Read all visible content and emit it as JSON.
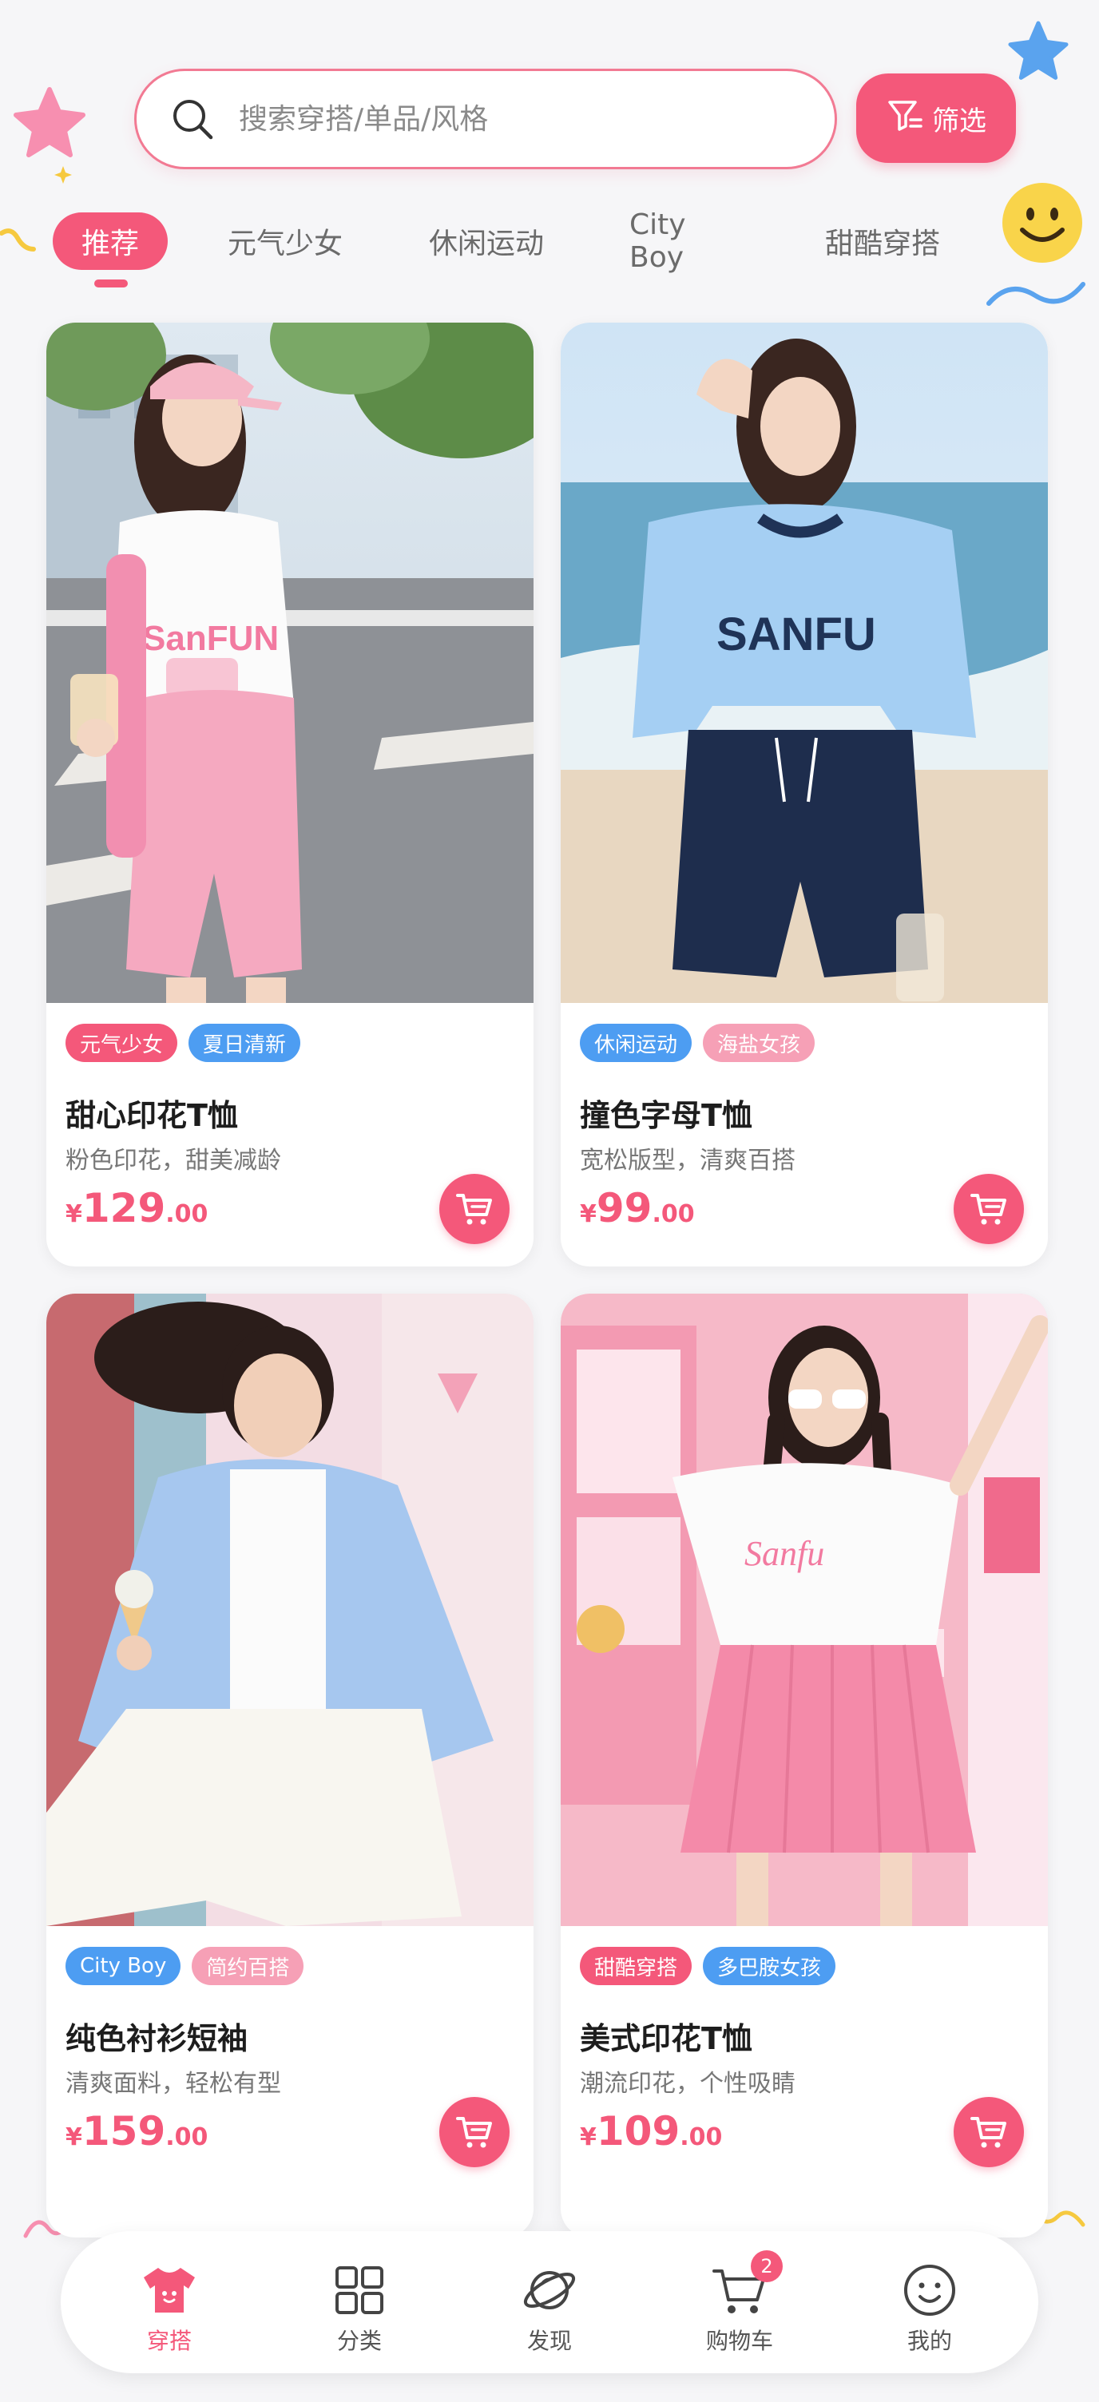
{
  "search": {
    "placeholder": "搜索穿搭/单品/风格"
  },
  "filter": {
    "label": "筛选",
    "icon": "filter-icon"
  },
  "tabs": [
    {
      "label": "推荐",
      "active": true
    },
    {
      "label": "元气少女"
    },
    {
      "label": "休闲运动"
    },
    {
      "label": "City Boy"
    },
    {
      "label": "甜酷穿搭"
    }
  ],
  "products": [
    {
      "tags": [
        "元气少女",
        "夏日清新"
      ],
      "title": "甜心印花T恤",
      "subtitle": "粉色印花，甜美减龄",
      "currency": "¥",
      "price_int": "129",
      "price_dec": ".00",
      "shirt_print": "SanFUN"
    },
    {
      "tags": [
        "休闲运动",
        "海盐女孩"
      ],
      "title": "撞色字母T恤",
      "subtitle": "宽松版型，清爽百搭",
      "currency": "¥",
      "price_int": "99",
      "price_dec": ".00",
      "shirt_print": "SANFU"
    },
    {
      "tags": [
        "City Boy",
        "简约百搭"
      ],
      "title": "纯色衬衫短袖",
      "subtitle": "清爽面料，轻松有型",
      "currency": "¥",
      "price_int": "159",
      "price_dec": ".00"
    },
    {
      "tags": [
        "甜酷穿搭",
        "多巴胺女孩"
      ],
      "title": "美式印花T恤",
      "subtitle": "潮流印花，个性吸睛",
      "currency": "¥",
      "price_int": "109",
      "price_dec": ".00",
      "shirt_print": "Sanfu"
    }
  ],
  "nav": [
    {
      "label": "穿搭",
      "icon": "tshirt-icon",
      "active": true
    },
    {
      "label": "分类",
      "icon": "grid-icon"
    },
    {
      "label": "发现",
      "icon": "planet-icon"
    },
    {
      "label": "购物车",
      "icon": "cart-icon",
      "badge": "2"
    },
    {
      "label": "我的",
      "icon": "smiley-icon"
    }
  ],
  "colors": {
    "accent": "#f4587a",
    "blue": "#4d9df2",
    "light_pink": "#f6a0b6",
    "background": "#f6f6f8"
  }
}
